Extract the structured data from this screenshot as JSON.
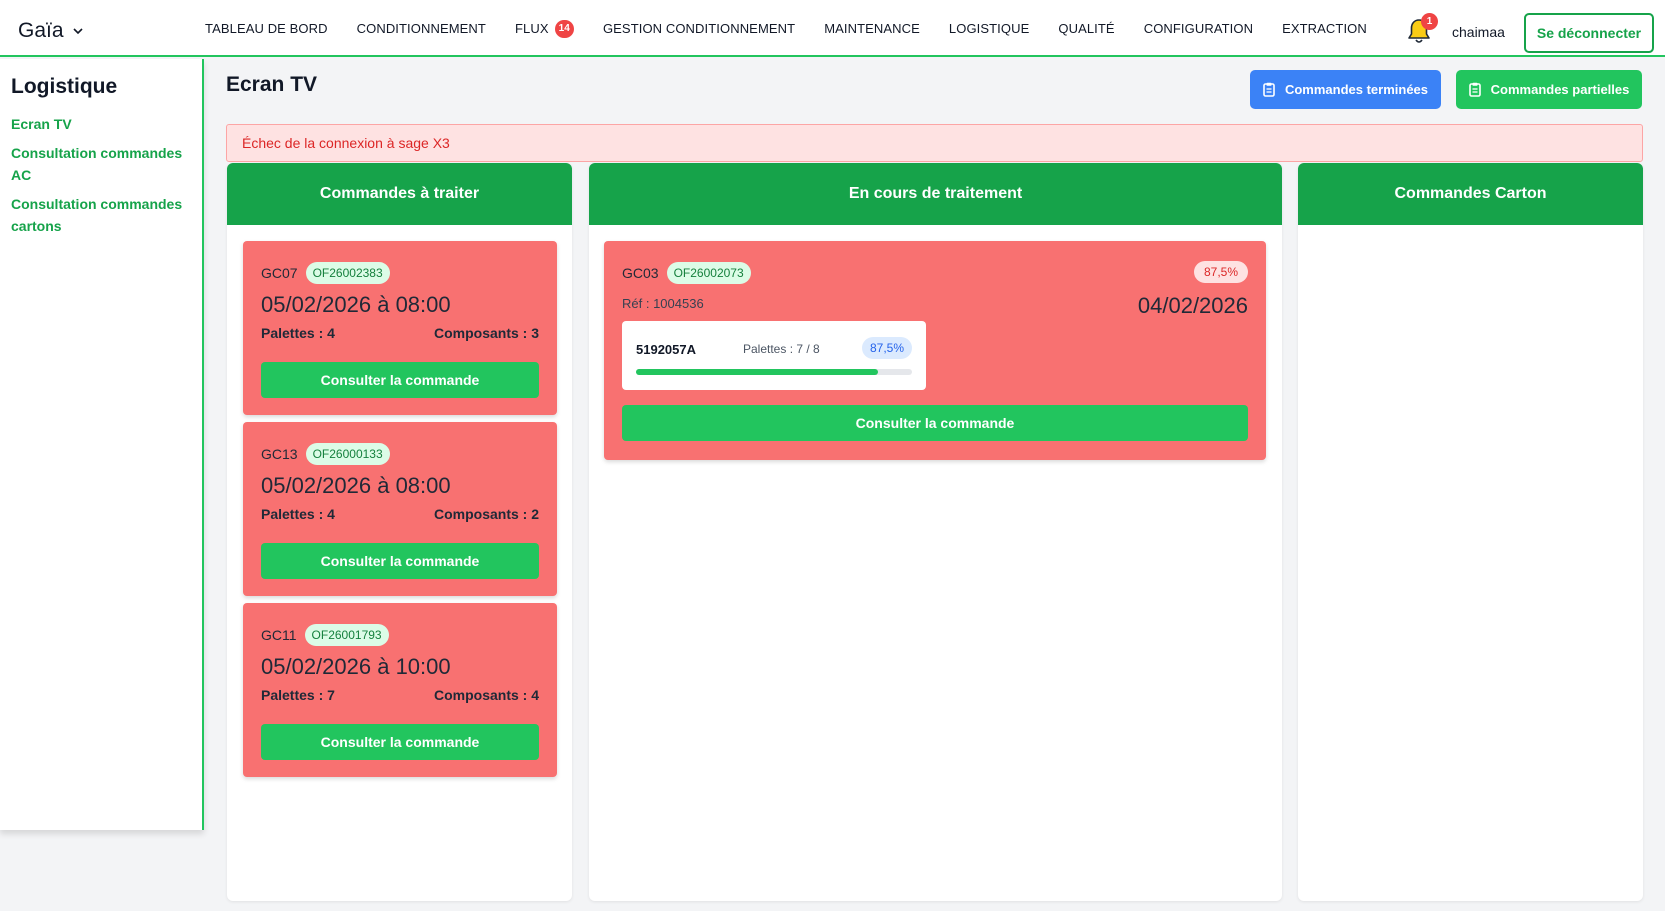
{
  "header": {
    "brand": "Gaïa",
    "nav": [
      {
        "label": "TABLEAU DE BORD"
      },
      {
        "label": "CONDITIONNEMENT"
      },
      {
        "label": "FLUX",
        "badge": "14"
      },
      {
        "label": "GESTION CONDITIONNEMENT"
      },
      {
        "label": "MAINTENANCE"
      },
      {
        "label": "LOGISTIQUE"
      },
      {
        "label": "QUALITÉ"
      },
      {
        "label": "CONFIGURATION"
      },
      {
        "label": "EXTRACTION"
      }
    ],
    "notifications": "1",
    "user": "chaimaa",
    "logout": "Se déconnecter"
  },
  "sidebar": {
    "title": "Logistique",
    "links": [
      "Ecran TV",
      "Consultation commandes AC",
      "Consultation commandes cartons"
    ]
  },
  "main": {
    "title": "Ecran TV",
    "btn_done": "Commandes terminées",
    "btn_partial": "Commandes partielles",
    "alert": "Échec de la connexion à sage X3",
    "columns": [
      "Commandes à traiter",
      "En cours de traitement",
      "Commandes Carton"
    ],
    "todo": [
      {
        "code": "GC07",
        "of": "OF26002383",
        "date": "05/02/2026 à 08:00",
        "palettes": "Palettes : 4",
        "composants": "Composants : 3",
        "btn": "Consulter la commande"
      },
      {
        "code": "GC13",
        "of": "OF26000133",
        "date": "05/02/2026 à 08:00",
        "palettes": "Palettes : 4",
        "composants": "Composants : 2",
        "btn": "Consulter la commande"
      },
      {
        "code": "GC11",
        "of": "OF26001793",
        "date": "05/02/2026 à 10:00",
        "palettes": "Palettes : 7",
        "composants": "Composants : 4",
        "btn": "Consulter la commande"
      }
    ],
    "inprogress": {
      "code": "GC03",
      "of": "OF26002073",
      "pct": "87,5%",
      "ref": "Réf : 1004536",
      "date": "04/02/2026",
      "item": {
        "code": "5192057A",
        "palettes": "Palettes : 7 / 8",
        "pct": "87,5%",
        "progress": 0.875
      },
      "btn": "Consulter la commande"
    }
  },
  "colors": {
    "green": "#16a34a",
    "accent_green": "#22c55e",
    "blue": "#3b82f6",
    "card_red": "#f87171"
  }
}
